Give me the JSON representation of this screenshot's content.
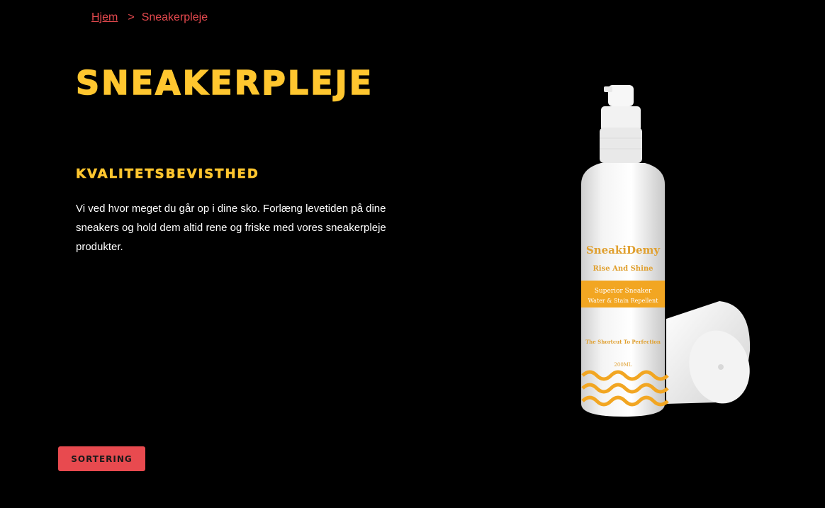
{
  "breadcrumb": {
    "home_label": "Hjem",
    "separator": ">",
    "current_label": "Sneakerpleje"
  },
  "page": {
    "title": "SNEAKERPLEJE",
    "section_title": "KVALITETSBEVISTHED",
    "description": "Vi ved hvor meget du går op i dine sko. Forlæng levetiden på dine sneakers og hold dem altid rene og friske med vores sneakerpleje produkter."
  },
  "product_image": {
    "brand": "SneakiDemy",
    "tagline": "Rise And Shine",
    "label_line1": "Superior Sneaker",
    "label_line2": "Water & Stain Repellent",
    "slogan": "The Shortcut To Perfection",
    "volume": "200ML"
  },
  "sort_button": {
    "label": "SORTERING"
  },
  "colors": {
    "background": "#000000",
    "accent_yellow": "#ffc62f",
    "accent_red": "#e84a4f",
    "label_orange": "#f2a622"
  }
}
